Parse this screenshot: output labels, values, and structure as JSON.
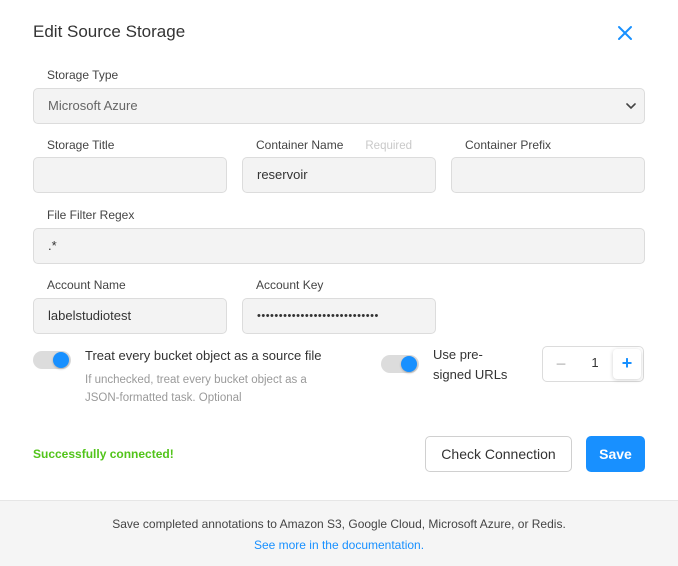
{
  "modal": {
    "title": "Edit Source Storage"
  },
  "form": {
    "storage_type": {
      "label": "Storage Type",
      "value": "Microsoft Azure"
    },
    "storage_title": {
      "label": "Storage Title",
      "value": ""
    },
    "container_name": {
      "label": "Container Name",
      "required_hint": "Required",
      "value": "reservoir"
    },
    "container_prefix": {
      "label": "Container Prefix",
      "value": ""
    },
    "file_filter_regex": {
      "label": "File Filter Regex",
      "value": ".*"
    },
    "account_name": {
      "label": "Account Name",
      "value": "labelstudiotest"
    },
    "account_key": {
      "label": "Account Key",
      "value": "••••••••••••••••••••••••••••"
    },
    "treat_as_source": {
      "label": "Treat every bucket object as a source file",
      "hint_line1": "If unchecked, treat every bucket object as a",
      "hint_line2": "JSON-formatted task. Optional",
      "enabled": true
    },
    "presigned_urls": {
      "label_line1": "Use pre-",
      "label_line2": "signed URLs",
      "enabled": true
    },
    "stepper": {
      "minus": "−",
      "value": "1",
      "plus": "+"
    }
  },
  "status": {
    "message": "Successfully connected!",
    "color": "#52c41a"
  },
  "actions": {
    "check_connection": "Check Connection",
    "save": "Save"
  },
  "footer": {
    "text": "Save completed annotations to Amazon S3, Google Cloud, Microsoft Azure, or Redis.",
    "link_text": "See more in the documentation",
    "link_suffix": "."
  },
  "colors": {
    "accent": "#1890ff",
    "success": "#52c41a"
  },
  "icons": {
    "close": "close-icon",
    "dropdown": "chevron-down-icon"
  }
}
